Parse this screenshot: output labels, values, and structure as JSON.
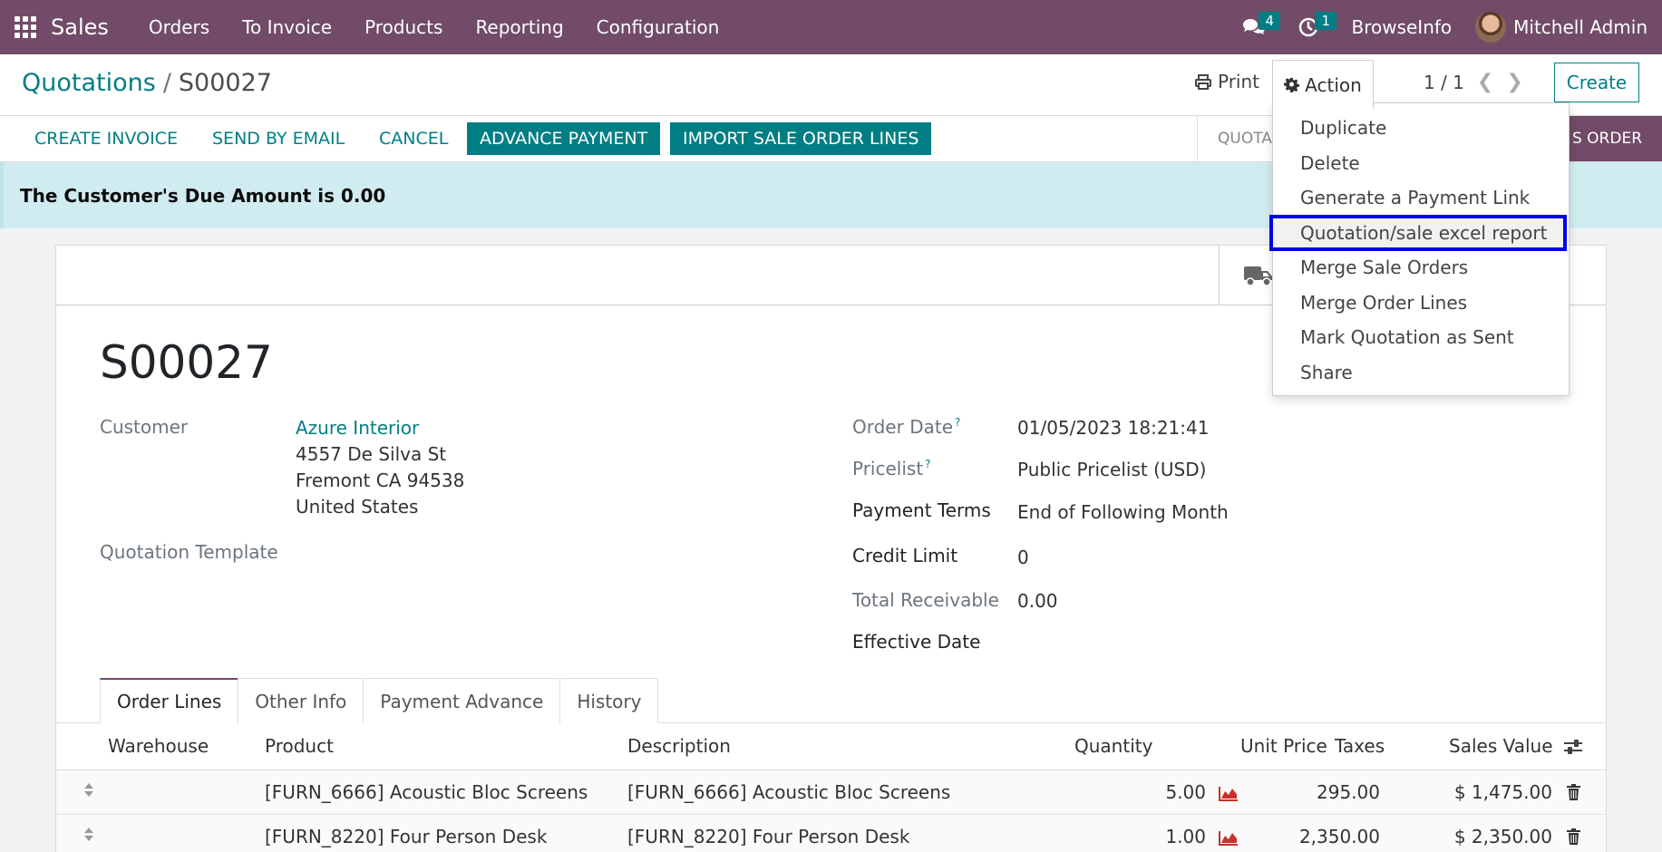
{
  "topbar": {
    "app_name": "Sales",
    "menu": [
      "Orders",
      "To Invoice",
      "Products",
      "Reporting",
      "Configuration"
    ],
    "messages_count": "4",
    "activities_count": "1",
    "company": "BrowseInfo",
    "user": "Mitchell Admin",
    "color": "#714b67"
  },
  "control": {
    "breadcrumb_parent": "Quotations",
    "breadcrumb_sep": "/",
    "breadcrumb_current": "S00027",
    "print_label": "Print",
    "action_label": "Action",
    "pager": "1 / 1",
    "create_label": "Create"
  },
  "statusbar": {
    "buttons": [
      "CREATE INVOICE",
      "SEND BY EMAIL",
      "CANCEL",
      "ADVANCE PAYMENT",
      "IMPORT SALE ORDER LINES"
    ],
    "stage_left": "QUOTA",
    "stage_right": "S ORDER"
  },
  "alert": {
    "text": "The Customer's Due Amount is 0.00"
  },
  "form": {
    "title": "S00027",
    "customer_label": "Customer",
    "customer_name": "Azure Interior",
    "address_line1": "4557 De Silva St",
    "address_line2": "Fremont CA 94538",
    "address_line3": "United States",
    "quotation_template_label": "Quotation Template",
    "order_date_label": "Order Date",
    "order_date": "01/05/2023 18:21:41",
    "pricelist_label": "Pricelist",
    "pricelist": "Public Pricelist (USD)",
    "payment_terms_label": "Payment Terms",
    "payment_terms": "End of Following Month",
    "credit_limit_label": "Credit Limit",
    "credit_limit": "0",
    "total_receivable_label": "Total Receivable",
    "total_receivable": "0.00",
    "effective_date_label": "Effective Date",
    "help_mark": "?"
  },
  "tabs": [
    "Order Lines",
    "Other Info",
    "Payment Advance",
    "History"
  ],
  "table": {
    "headers": {
      "warehouse": "Warehouse",
      "product": "Product",
      "description": "Description",
      "quantity": "Quantity",
      "unit_price": "Unit Price",
      "taxes": "Taxes",
      "sales_value": "Sales Value"
    },
    "rows": [
      {
        "product": "[FURN_6666] Acoustic Bloc Screens",
        "description": "[FURN_6666] Acoustic Bloc Screens",
        "quantity": "5.00",
        "unit_price": "295.00",
        "sales_value": "$ 1,475.00"
      },
      {
        "product": "[FURN_8220] Four Person Desk",
        "description": "[FURN_8220] Four Person Desk",
        "quantity": "1.00",
        "unit_price": "2,350.00",
        "sales_value": "$ 2,350.00"
      }
    ]
  },
  "action_menu": {
    "items": [
      "Duplicate",
      "Delete",
      "Generate a Payment Link",
      "Quotation/sale excel report",
      "Merge Sale Orders",
      "Merge Order Lines",
      "Mark Quotation as Sent",
      "Share"
    ],
    "highlighted": "Quotation/sale excel report",
    "highlight_color": "#0000e6"
  },
  "colors": {
    "accent": "#017e84",
    "brand": "#714b67",
    "alert_bg": "#d1ecf1",
    "forecast_icon": "#c9302c"
  }
}
